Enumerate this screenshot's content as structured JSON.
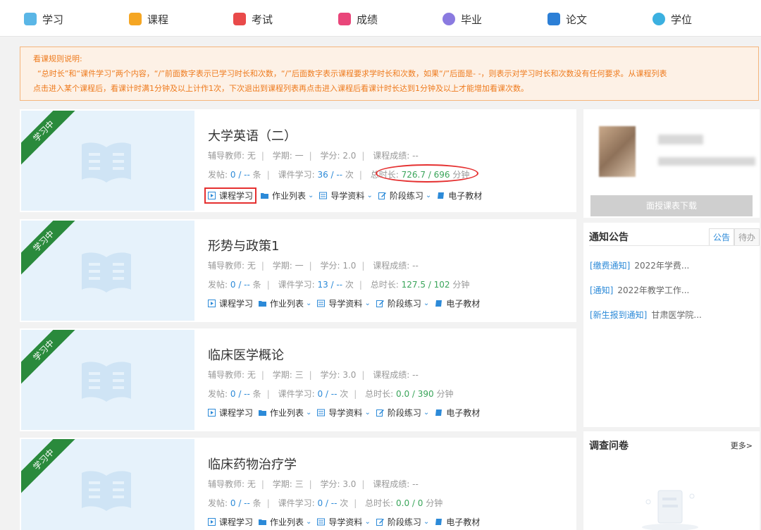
{
  "nav": [
    {
      "label": "学习",
      "icon": "study-icon",
      "color": "#5ab6e6"
    },
    {
      "label": "课程",
      "icon": "course-icon",
      "color": "#f5a623"
    },
    {
      "label": "考试",
      "icon": "exam-icon",
      "color": "#e94a4a"
    },
    {
      "label": "成绩",
      "icon": "score-icon",
      "color": "#e9467a"
    },
    {
      "label": "毕业",
      "icon": "graduate-icon",
      "color": "#8a7ae0"
    },
    {
      "label": "论文",
      "icon": "thesis-icon",
      "color": "#2c7fd6"
    },
    {
      "label": "学位",
      "icon": "degree-icon",
      "color": "#3bb0e0"
    }
  ],
  "notice": {
    "title": "看课规则说明:",
    "line1": "“总时长”和“课件学习”两个内容，“/”前面数字表示已学习时长和次数，“/”后面数字表示课程要求学时长和次数，如果“/”后面是- -，则表示对学习时长和次数没有任何要求。从课程列表",
    "line2": "点击进入某个课程后，看课计时满1分钟及以上计作1次，下次退出到课程列表再点击进入课程后看课计时长达到1分钟及以上才能增加看课次数。"
  },
  "courses": [
    {
      "title": "大学英语（二）",
      "badge": "学习中",
      "teacher": "辅导教师: 无",
      "term": "学期: 一",
      "credit": "学分: 2.0",
      "grade": "课程成绩: --",
      "posts_label": "发帖:",
      "posts_value": "0 / --",
      "posts_unit": "条",
      "ware_label": "课件学习:",
      "ware_value": "36 / --",
      "ware_unit": "次",
      "time_label": "总时长:",
      "time_value": "726.7 / 696",
      "time_unit": "分钟"
    },
    {
      "title": "形势与政策1",
      "badge": "学习中",
      "teacher": "辅导教师: 无",
      "term": "学期: 一",
      "credit": "学分: 1.0",
      "grade": "课程成绩: --",
      "posts_label": "发帖:",
      "posts_value": "0 / --",
      "posts_unit": "条",
      "ware_label": "课件学习:",
      "ware_value": "13 / --",
      "ware_unit": "次",
      "time_label": "总时长:",
      "time_value": "127.5 / 102",
      "time_unit": "分钟"
    },
    {
      "title": "临床医学概论",
      "badge": "学习中",
      "teacher": "辅导教师: 无",
      "term": "学期: 三",
      "credit": "学分: 3.0",
      "grade": "课程成绩: --",
      "posts_label": "发帖:",
      "posts_value": "0 / --",
      "posts_unit": "条",
      "ware_label": "课件学习:",
      "ware_value": "0 / --",
      "ware_unit": "次",
      "time_label": "总时长:",
      "time_value": "0.0 / 390",
      "time_unit": "分钟"
    },
    {
      "title": "临床药物治疗学",
      "badge": "学习中",
      "teacher": "辅导教师: 无",
      "term": "学期: 三",
      "credit": "学分: 3.0",
      "grade": "课程成绩: --",
      "posts_label": "发帖:",
      "posts_value": "0 / --",
      "posts_unit": "条",
      "ware_label": "课件学习:",
      "ware_value": "0 / --",
      "ware_unit": "次",
      "time_label": "总时长:",
      "time_value": "0.0 / 0",
      "time_unit": "分钟"
    }
  ],
  "course_links": {
    "study": "课程学习",
    "homework": "作业列表",
    "guide": "导学资料",
    "practice": "阶段练习",
    "ebook": "电子教材"
  },
  "sidebar": {
    "download_button": "面授课表下载",
    "notice_title": "通知公告",
    "tab_notice": "公告",
    "tab_todo": "待办",
    "news": [
      {
        "tag": "[缴费通知]",
        "text": "2022年学费..."
      },
      {
        "tag": "[通知]",
        "text": "2022年教学工作..."
      },
      {
        "tag": "[新生报到通知]",
        "text": "甘肃医学院..."
      }
    ],
    "survey_title": "调查问卷",
    "more": "更多>"
  }
}
